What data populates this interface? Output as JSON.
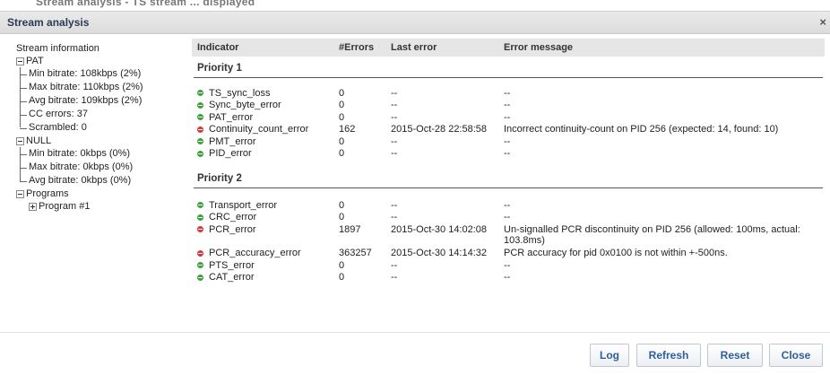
{
  "cutoff_text": "Stream analysis - TS stream ... displayed",
  "dialog": {
    "title": "Stream analysis",
    "close_glyph": "×"
  },
  "tree": {
    "root": "Stream information",
    "pat": {
      "label": "PAT",
      "items": [
        "Min bitrate: 108kbps (2%)",
        "Max bitrate: 110kbps (2%)",
        "Avg bitrate: 109kbps (2%)",
        "CC errors: 37",
        "Scrambled: 0"
      ]
    },
    "null": {
      "label": "NULL",
      "items": [
        "Min bitrate: 0kbps (0%)",
        "Max bitrate: 0kbps (0%)",
        "Avg bitrate: 0kbps (0%)"
      ]
    },
    "programs": {
      "label": "Programs",
      "items": [
        "Program #1"
      ]
    }
  },
  "table": {
    "headers": {
      "indicator": "Indicator",
      "errors": "#Errors",
      "last_error": "Last error",
      "message": "Error message"
    },
    "priority1": {
      "label": "Priority 1",
      "rows": [
        {
          "indicator": "TS_sync_loss",
          "errors": "0",
          "last": "--",
          "msg": "--",
          "status": "ok"
        },
        {
          "indicator": "Sync_byte_error",
          "errors": "0",
          "last": "--",
          "msg": "--",
          "status": "ok"
        },
        {
          "indicator": "PAT_error",
          "errors": "0",
          "last": "--",
          "msg": "--",
          "status": "ok"
        },
        {
          "indicator": "Continuity_count_error",
          "errors": "162",
          "last": "2015-Oct-28 22:58:58",
          "msg": "Incorrect continuity-count on PID 256 (expected: 14, found: 10)",
          "status": "error"
        },
        {
          "indicator": "PMT_error",
          "errors": "0",
          "last": "--",
          "msg": "--",
          "status": "ok"
        },
        {
          "indicator": "PID_error",
          "errors": "0",
          "last": "--",
          "msg": "--",
          "status": "ok"
        }
      ]
    },
    "priority2": {
      "label": "Priority 2",
      "rows": [
        {
          "indicator": "Transport_error",
          "errors": "0",
          "last": "--",
          "msg": "--",
          "status": "ok"
        },
        {
          "indicator": "CRC_error",
          "errors": "0",
          "last": "--",
          "msg": "--",
          "status": "ok"
        },
        {
          "indicator": "PCR_error",
          "errors": "1897",
          "last": "2015-Oct-30 14:02:08",
          "msg": "Un-signalled PCR discontinuity on PID 256 (allowed: 100ms, actual: 103.8ms)",
          "status": "error"
        },
        {
          "indicator": "PCR_accuracy_error",
          "errors": "363257",
          "last": "2015-Oct-30 14:14:32",
          "msg": "PCR accuracy for pid 0x0100 is not within +-500ns.",
          "status": "error"
        },
        {
          "indicator": "PTS_error",
          "errors": "0",
          "last": "--",
          "msg": "--",
          "status": "ok"
        },
        {
          "indicator": "CAT_error",
          "errors": "0",
          "last": "--",
          "msg": "--",
          "status": "ok"
        }
      ]
    }
  },
  "buttons": {
    "log": "Log",
    "refresh": "Refresh",
    "reset": "Reset",
    "close": "Close"
  },
  "colors": {
    "ok": "#3ca33c",
    "error": "#d9363e",
    "button_text": "#2f5e99",
    "title_text": "#2a3a55"
  }
}
